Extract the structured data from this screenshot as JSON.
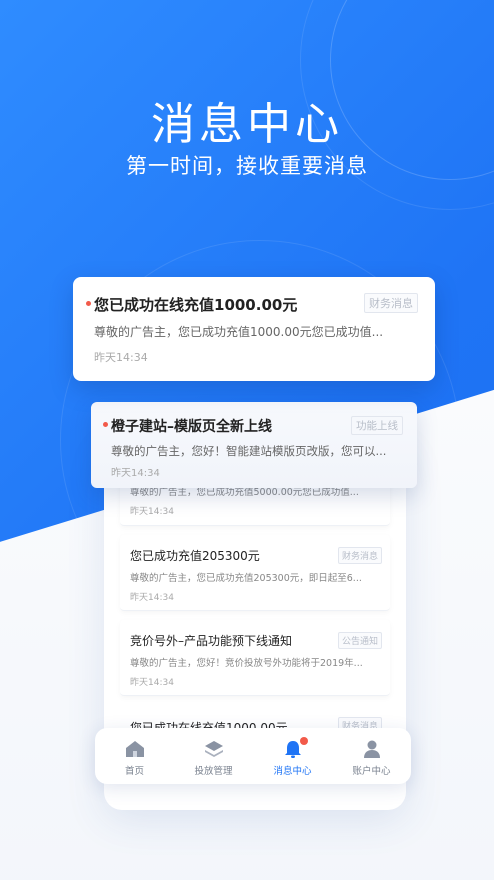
{
  "header": {
    "title": "消息中心",
    "subtitle": "第一时间，接收重要消息"
  },
  "featured_cards": [
    {
      "title": "您已成功在线充值1000.00元",
      "body": "尊敬的广告主，您已成功充值1000.00元您已成功值...",
      "time": "昨天14:34",
      "tag": "财务消息"
    },
    {
      "title": "橙子建站–模版页全新上线",
      "body": "尊敬的广告主，您好！智能建站模版页改版，您可以...",
      "time": "昨天14:34",
      "tag": "功能上线"
    }
  ],
  "list_items": [
    {
      "title": "",
      "body": "尊敬的广告主，您已成功充值5000.00元您已成功值...",
      "time": "昨天14:34",
      "tag": ""
    },
    {
      "title": "您已成功充值205300元",
      "body": "尊敬的广告主，您已成功充值205300元，即日起至6...",
      "time": "昨天14:34",
      "tag": "财务消息"
    },
    {
      "title": "竞价号外–产品功能预下线通知",
      "body": "尊敬的广告主，您好！竞价投放号外功能将于2019年...",
      "time": "昨天14:34",
      "tag": "公告通知"
    },
    {
      "title": "您已成功在线充值1000.00元",
      "body": "",
      "time": "",
      "tag": "财务消息"
    }
  ],
  "tabbar": {
    "items": [
      {
        "label": "首页",
        "icon": "home-icon"
      },
      {
        "label": "投放管理",
        "icon": "layers-icon"
      },
      {
        "label": "消息中心",
        "icon": "bell-icon",
        "active": true
      },
      {
        "label": "账户中心",
        "icon": "user-icon"
      }
    ]
  },
  "colors": {
    "primary": "#1f74f5",
    "badge": "#f25a4a"
  }
}
